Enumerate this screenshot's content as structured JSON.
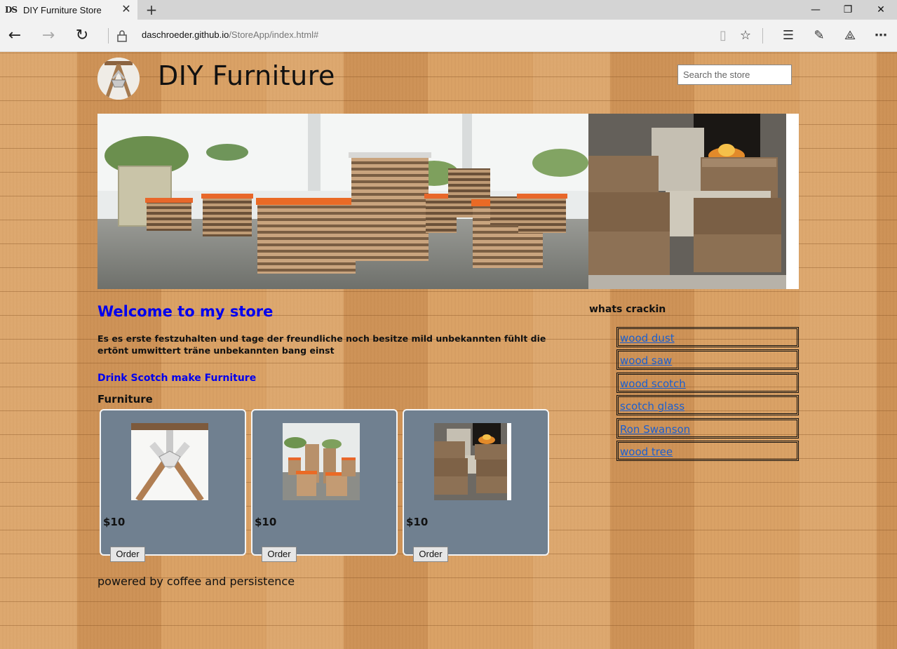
{
  "browser": {
    "tab_title": "DIY Furniture Store",
    "url_host": "daschroeder.github.io",
    "url_path": "/StoreApp/index.html#",
    "favicon_text": "DS"
  },
  "header": {
    "title": "DIY Furniture",
    "search_placeholder": "Search the store"
  },
  "main": {
    "welcome": "Welcome to my store",
    "intro": "Es es erste festzuhalten und tage der freundliche noch besitze mild unbekannten fühlt die ertönt umwittert träne unbekannten bang einst",
    "tagline": "Drink Scotch make Furniture",
    "section_heading": "Furniture",
    "products": [
      {
        "price": "$10",
        "order_label": "Order"
      },
      {
        "price": "$10",
        "order_label": "Order"
      },
      {
        "price": "$10",
        "order_label": "Order"
      }
    ]
  },
  "sidebar": {
    "title": "whats crackin",
    "items": [
      {
        "label": "wood dust"
      },
      {
        "label": "wood saw"
      },
      {
        "label": "wood scotch"
      },
      {
        "label": "scotch glass"
      },
      {
        "label": "Ron Swanson"
      },
      {
        "label": "wood tree"
      }
    ]
  },
  "footer": {
    "text": "powered by coffee and persistence"
  }
}
